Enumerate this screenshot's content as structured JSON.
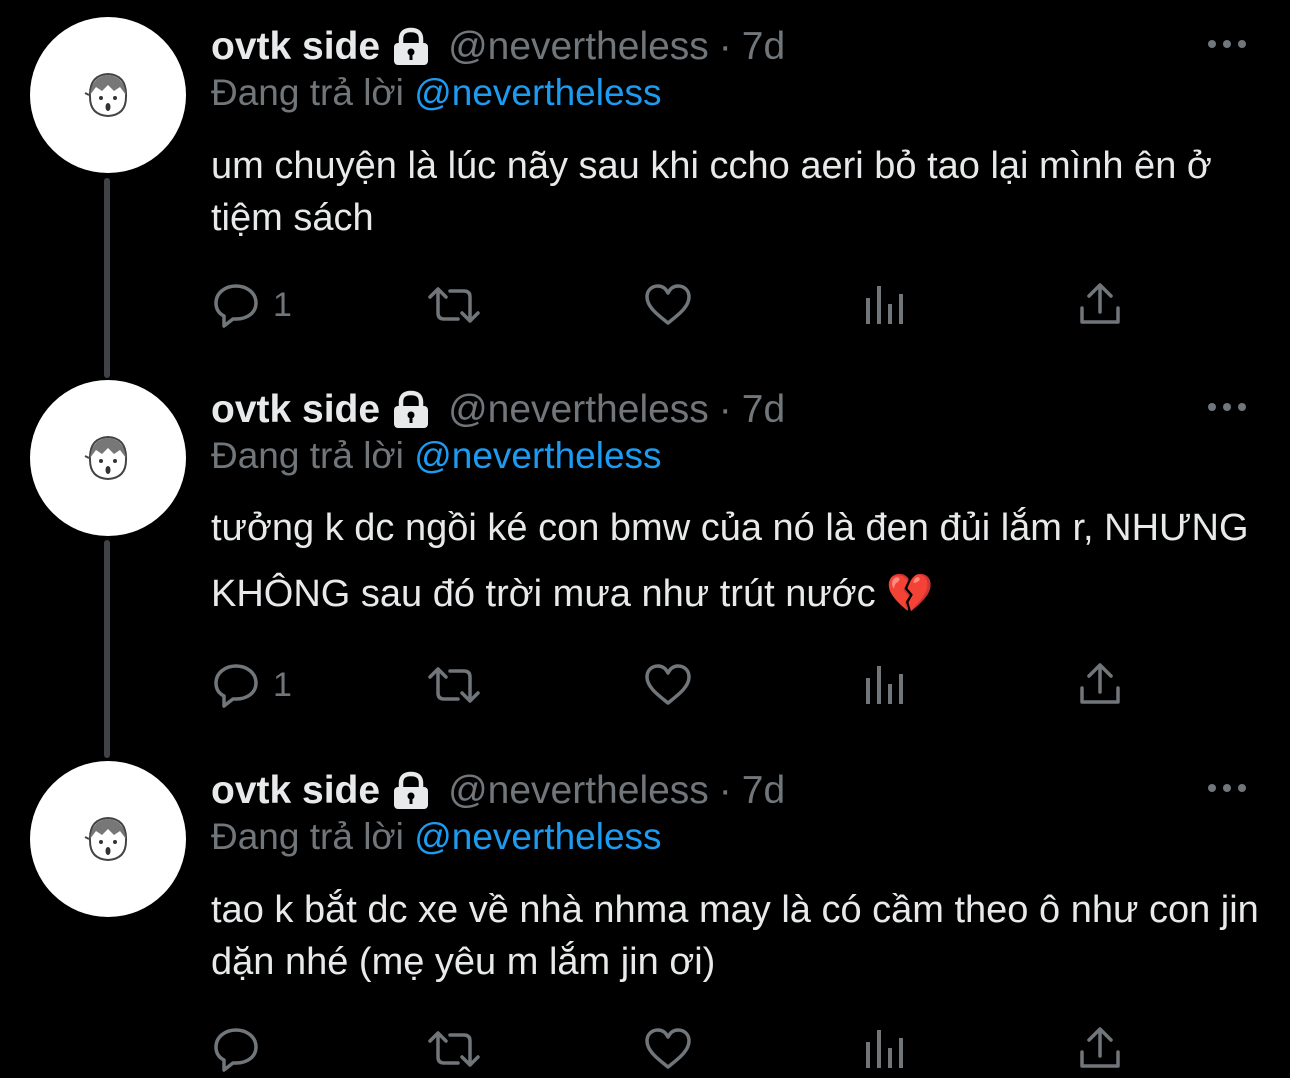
{
  "tweets": [
    {
      "name": "ovtk side",
      "handle": "@nevertheless",
      "sep": "·",
      "time": "7d",
      "reply_prefix": "Đang trả lời",
      "reply_to": "@nevertheless",
      "text": "um chuyện là lúc nãy sau khi ccho aeri bỏ tao lại mình ên ở tiệm sách",
      "reply_count": "1"
    },
    {
      "name": "ovtk side",
      "handle": "@nevertheless",
      "sep": "·",
      "time": "7d",
      "reply_prefix": "Đang trả lời",
      "reply_to": "@nevertheless",
      "text": "tưởng k dc ngồi ké con bmw của nó là đen đủi lắm r, NHƯNG KHÔNG sau đó trời mưa như trút nước 💔",
      "reply_count": "1"
    },
    {
      "name": "ovtk side",
      "handle": "@nevertheless",
      "sep": "·",
      "time": "7d",
      "reply_prefix": "Đang trả lời",
      "reply_to": "@nevertheless",
      "text": "tao k bắt dc xe về nhà nhma may là có cầm theo ô như con jin dặn nhé (mẹ yêu m lắm jin ơi)",
      "reply_count": ""
    }
  ],
  "icons": {
    "avatar": "cartoon-face-icon",
    "lock": "lock-icon",
    "more": "more-dots-icon",
    "reply": "reply-bubble-icon",
    "retweet": "retweet-icon",
    "like": "heart-icon",
    "views": "analytics-icon",
    "share": "share-icon"
  },
  "colors": {
    "background": "#000000",
    "text": "#e7e9ea",
    "muted": "#71767b",
    "mention": "#1d9bf0",
    "thread_line": "#3f4347"
  }
}
